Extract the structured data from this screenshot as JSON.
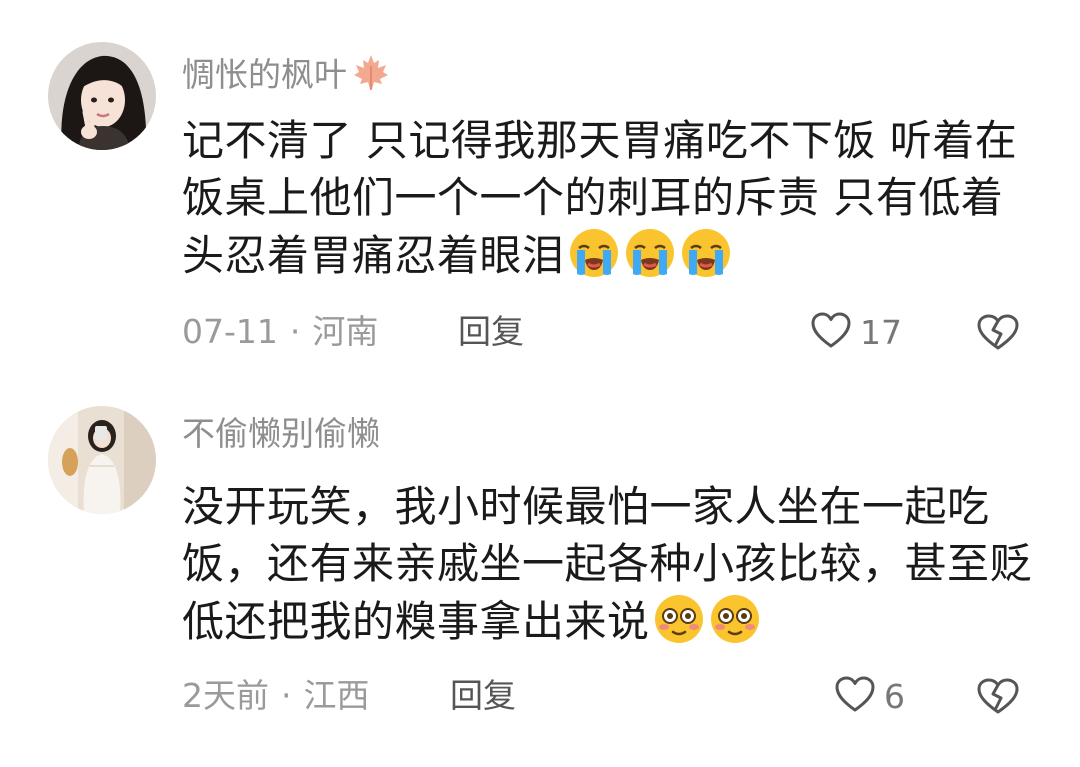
{
  "comments": [
    {
      "username": "惆怅的枫叶",
      "username_emoji": "maple-leaf-icon",
      "text": "记不清了 只记得我那天胃痛吃不下饭 听着在饭桌上他们一个一个的刺耳的斥责 只有低着头忍着胃痛忍着眼泪",
      "emojis": [
        "loudly-crying-face-icon",
        "loudly-crying-face-icon",
        "loudly-crying-face-icon"
      ],
      "time": "07-11",
      "separator": "·",
      "location": "河南",
      "reply_label": "回复",
      "likes": "17"
    },
    {
      "username": "不偷懒别偷懒",
      "text": "没开玩笑，我小时候最怕一家人坐在一起吃饭，还有来亲戚坐一起各种小孩比较，甚至贬低还把我的糗事拿出来说",
      "emojis": [
        "flushed-face-icon",
        "flushed-face-icon"
      ],
      "time": "2天前",
      "separator": "·",
      "location": "江西",
      "reply_label": "回复",
      "likes": "6"
    }
  ],
  "colors": {
    "username": "#8e8e8e",
    "body_text": "#1a1a1a",
    "meta": "#9a9a9a",
    "emoji_yellow": "#f9c42d",
    "tear_blue": "#3fa9f5"
  }
}
